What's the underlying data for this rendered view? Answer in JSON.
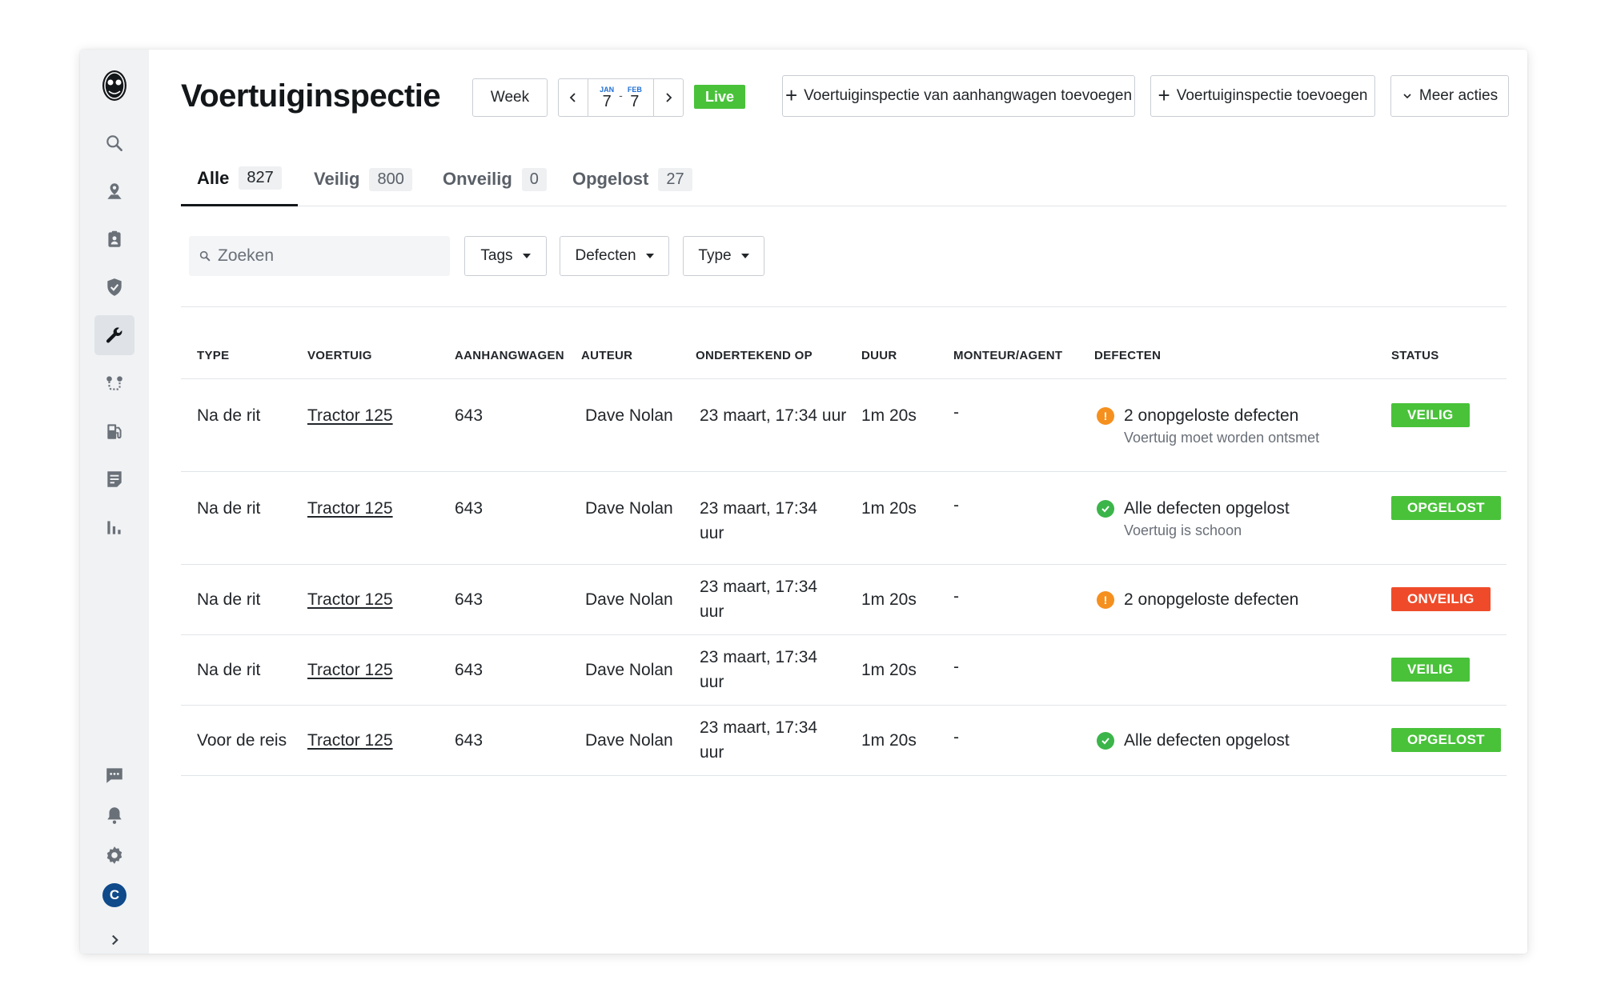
{
  "sidebar": {
    "items": [
      {
        "icon": "search-icon"
      },
      {
        "icon": "map-pin-icon"
      },
      {
        "icon": "clipboard-icon"
      },
      {
        "icon": "shield-icon"
      },
      {
        "icon": "wrench-icon",
        "active": true
      },
      {
        "icon": "route-icon"
      },
      {
        "icon": "fuel-icon"
      },
      {
        "icon": "document-icon"
      },
      {
        "icon": "bar-chart-icon"
      }
    ],
    "bottom_items": [
      {
        "icon": "chat-icon"
      },
      {
        "icon": "bell-icon"
      },
      {
        "icon": "gear-icon"
      }
    ],
    "avatar_initial": "C"
  },
  "header": {
    "title": "Voertuiginspectie",
    "week_label": "Week",
    "date_range": {
      "start_month": "JAN",
      "start_day": "7",
      "end_month": "FEB",
      "end_day": "7"
    },
    "live_label": "Live",
    "add_trailer_label": "Voertuiginspectie van aanhangwagen toevoegen",
    "add_inspection_label": "Voertuiginspectie toevoegen",
    "more_actions_label": "Meer acties"
  },
  "tabs": [
    {
      "label": "Alle",
      "count": "827",
      "active": true
    },
    {
      "label": "Veilig",
      "count": "800"
    },
    {
      "label": "Onveilig",
      "count": "0"
    },
    {
      "label": "Opgelost",
      "count": "27"
    }
  ],
  "filters": {
    "search_placeholder": "Zoeken",
    "tags_label": "Tags",
    "defects_label": "Defecten",
    "type_label": "Type"
  },
  "table": {
    "columns": [
      "TYPE",
      "VOERTUIG",
      "AANHANGWAGEN",
      "AUTEUR",
      "ONDERTEKEND OP",
      "DUUR",
      "MONTEUR/AGENT",
      "DEFECTEN",
      "STATUS"
    ],
    "rows": [
      {
        "type": "Na de rit",
        "vehicle": "Tractor 125",
        "trailer": "643",
        "author": "Dave Nolan",
        "signed": "23 maart, 17:34 uur",
        "duration": "1m 20s",
        "mechanic": "-",
        "defect_icon": "warn",
        "defect": "2 onopgeloste defecten",
        "defect_note": "Voertuig moet worden ontsmet",
        "status": "VEILIG",
        "status_kind": "safe"
      },
      {
        "type": "Na de rit",
        "vehicle": "Tractor 125",
        "trailer": "643",
        "author": "Dave Nolan",
        "signed": "23 maart, 17:34 uur",
        "duration": "1m 20s",
        "mechanic": "-",
        "defect_icon": "ok",
        "defect": "Alle defecten opgelost",
        "defect_note": "Voertuig is schoon",
        "status": "OPGELOST",
        "status_kind": "resolved"
      },
      {
        "type": "Na de rit",
        "vehicle": "Tractor 125",
        "trailer": "643",
        "author": "Dave Nolan",
        "signed": "23 maart, 17:34 uur",
        "duration": "1m 20s",
        "mechanic": "-",
        "defect_icon": "warn",
        "defect": "2 onopgeloste defecten",
        "defect_note": "",
        "status": "ONVEILIG",
        "status_kind": "unsafe"
      },
      {
        "type": "Na de rit",
        "vehicle": "Tractor 125",
        "trailer": "643",
        "author": "Dave Nolan",
        "signed": "23 maart, 17:34 uur",
        "duration": "1m 20s",
        "mechanic": "-",
        "defect_icon": "",
        "defect": "",
        "defect_note": "",
        "status": "VEILIG",
        "status_kind": "safe"
      },
      {
        "type": "Voor de reis",
        "vehicle": "Tractor 125",
        "trailer": "643",
        "author": "Dave Nolan",
        "signed": "23 maart, 17:34 uur",
        "duration": "1m 20s",
        "mechanic": "-",
        "defect_icon": "ok",
        "defect": "Alle defecten opgelost",
        "defect_note": "",
        "status": "OPGELOST",
        "status_kind": "resolved"
      }
    ]
  }
}
